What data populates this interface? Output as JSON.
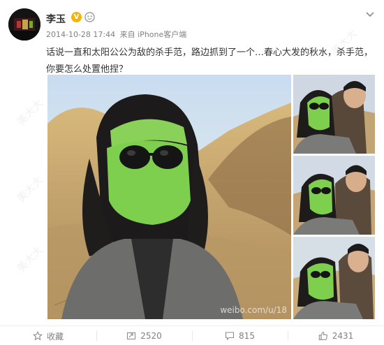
{
  "user": {
    "name": "李玉",
    "verified_badge": "V",
    "verified_color": "#f6b400"
  },
  "meta": {
    "time": "2014-10-28 17:44",
    "source_prefix": "来自",
    "client": "iPhone客户端"
  },
  "post": {
    "text": "话说一直和太阳公公为敌的杀手范，路边抓到了一个…春心大发的秋水，杀手范，你要怎么处置他捏？"
  },
  "photos": {
    "main_watermark": "weibo.com/u/18"
  },
  "watermark_text": "美大大",
  "actions": {
    "favorite": {
      "label": "收藏",
      "icon": "star-icon"
    },
    "repost": {
      "count": "2520",
      "icon": "repost-icon"
    },
    "comment": {
      "count": "815",
      "icon": "comment-icon"
    },
    "like": {
      "count": "2431",
      "icon": "thumbs-up-icon"
    }
  },
  "colors": {
    "accent": "#eb7350",
    "mask_green": "#7fcf4e",
    "muted": "#808080"
  }
}
